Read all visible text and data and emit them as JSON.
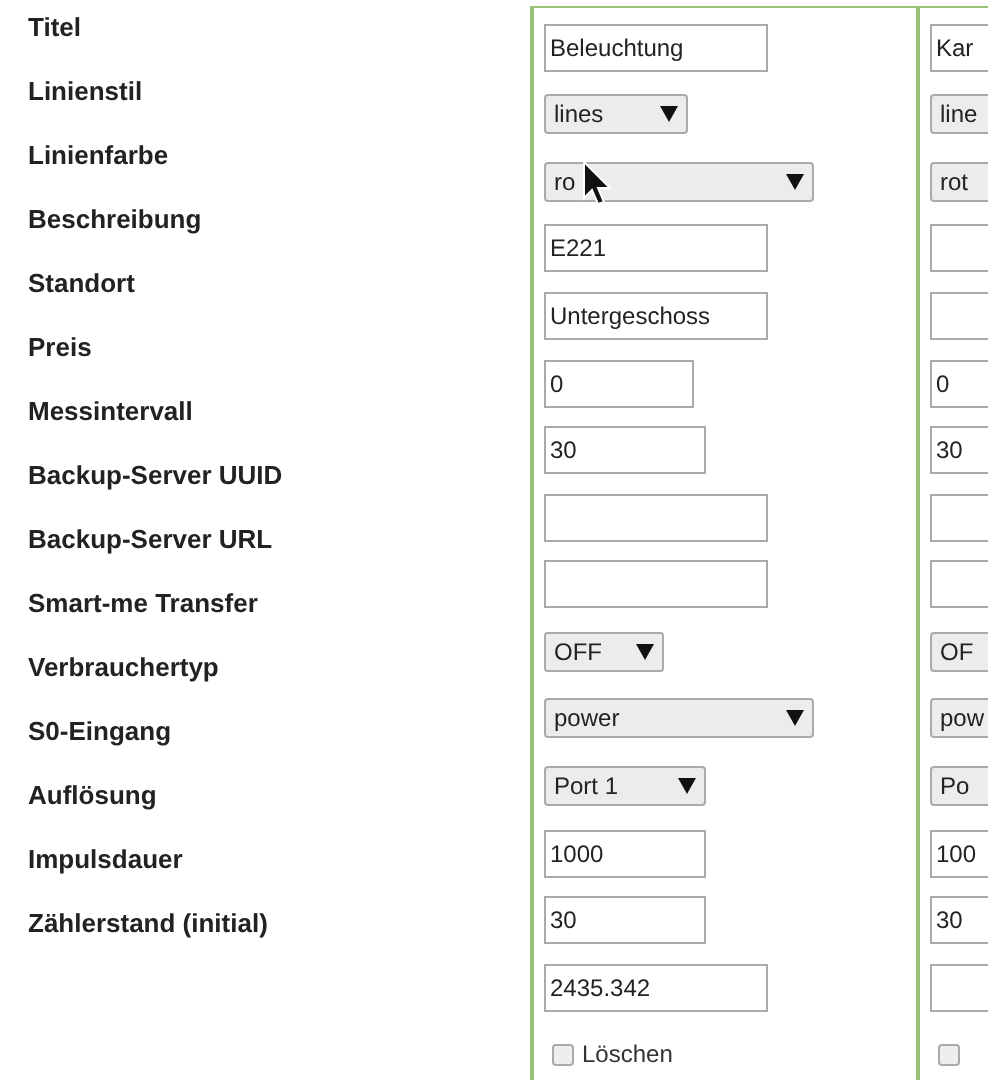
{
  "labels": [
    "Titel",
    "Linienstil",
    "Linienfarbe",
    "Beschreibung",
    "Standort",
    "Preis",
    "Messintervall",
    "Backup-Server UUID",
    "Backup-Server URL",
    "Smart-me Transfer",
    "Verbrauchertyp",
    "S0-Eingang",
    "Auflösung",
    "Impulsdauer",
    "Zählerstand (initial)"
  ],
  "columns": [
    {
      "fields": [
        {
          "kind": "text",
          "value": "Beleuchtung"
        },
        {
          "kind": "select",
          "value": "lines"
        },
        {
          "kind": "select",
          "value": "ro"
        },
        {
          "kind": "text",
          "value": "E221"
        },
        {
          "kind": "text",
          "value": "Untergeschoss"
        },
        {
          "kind": "text",
          "value": "0"
        },
        {
          "kind": "text",
          "value": "30"
        },
        {
          "kind": "text"
        },
        {
          "kind": "text"
        },
        {
          "kind": "select",
          "value": "OFF"
        },
        {
          "kind": "select",
          "value": "power"
        },
        {
          "kind": "select",
          "value": "Port 1"
        },
        {
          "kind": "text",
          "value": "1000"
        },
        {
          "kind": "text",
          "value": "30"
        },
        {
          "kind": "text",
          "value": "2435.342"
        },
        {
          "kind": "checkbox",
          "label": "Löschen",
          "checked": false
        }
      ]
    },
    {
      "fields": [
        {
          "kind": "text",
          "value": "Kar"
        },
        {
          "kind": "select",
          "value": "line"
        },
        {
          "kind": "select",
          "value": "rot"
        },
        {
          "kind": "text"
        },
        {
          "kind": "text"
        },
        {
          "kind": "text",
          "value": "0"
        },
        {
          "kind": "text",
          "value": "30"
        },
        {
          "kind": "text"
        },
        {
          "kind": "text"
        },
        {
          "kind": "select",
          "value": "OF"
        },
        {
          "kind": "select",
          "value": "pow"
        },
        {
          "kind": "select",
          "value": "Po"
        },
        {
          "kind": "text",
          "value": "100"
        },
        {
          "kind": "text",
          "value": "30"
        },
        {
          "kind": "text"
        },
        {
          "kind": "checkbox",
          "checked": false
        }
      ]
    }
  ]
}
